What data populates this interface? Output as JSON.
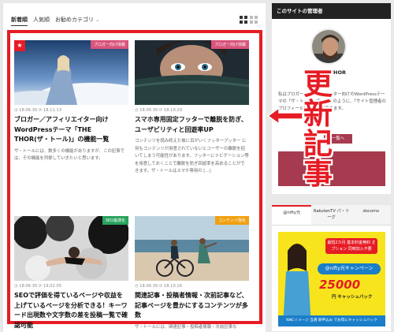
{
  "tabs": {
    "newest": "新着順",
    "popular": "人気順",
    "recommended": "お勧めカテゴリ"
  },
  "cards": [
    {
      "category": "ブロガー向け情報",
      "dates": "◷ 18.06.30  ⟳ 18.11.13",
      "title": "ブロガー／アフィリエイター向けWordPressテーマ「THE THOR(ザ・トール)」の機能一覧",
      "excerpt": "ザ・トールには、数多くの機能がありますが、この記事では、その機能を列挙していきたいと思います。"
    },
    {
      "category": "ブロガー向け情報",
      "dates": "◷ 18.06.30  ⟳ 18.10.29",
      "title": "スマホ専用固定フッターで離脱を防ぎ、ユーザビリティと回遊率UP",
      "excerpt": "コンテンツを読み終えた後に目がいくフッタープッター に何もコンテンツが用意されていないとユーザーの離脱を招いてしまう可能性があります。フッターにナビゲーション等を用意しておくことで離脱を防ぎ回遊率を高めることができます。ザ・トールはスマホ専用の [...]"
    },
    {
      "category": "SEO最適化",
      "dates": "◷ 18.06.30  ⟳ 19.02.05",
      "title": "SEOで評価を得ているページや収益を上げているページを分析できる！キーワード出現数や文字数の差を投稿一覧で確認可能",
      "excerpt": ""
    },
    {
      "category": "コンテンツ強化",
      "dates": "◷ 18.06.30  ⟳ 18.10.16",
      "title": "関連記事・投稿者情報・次前記事など、記事ページを豊かにするコンテンツが多数",
      "excerpt": "ザ・トールには、関連記事・投稿者情報・次前記事な"
    }
  ],
  "sidebar": {
    "admin_heading": "このサイトの管理者",
    "admin_name": "THE THOR",
    "admin_sub": "ーテ",
    "admin_desc": "私はブロガー・アフィリエイター向けのWordPressテーマの「ザ・トール」です。このように、「サイト管理者のプロフィール情報を掲載できます。",
    "admin_btn_mini": "一覧へ",
    "overlay": "更新記事",
    "ad_tabs": [
      "@nifty光",
      "RakutenTV\nパ・リーグ",
      "docomo"
    ],
    "ad_badge": "最短2カ月\n基本料金無料\nオプション\n同時加入不要",
    "ad_campaign": "@nifty光キャンペーン",
    "ad_amount": "25000",
    "ad_yen": "円 キャッシュバック",
    "ad_foot": "NNCイメージ 当選 新申込み でお得にキャッシュバック"
  },
  "colors": {
    "accent": "#e61c25",
    "admin_button": "#a63a4e",
    "ad_yellow": "#f7e41d"
  }
}
